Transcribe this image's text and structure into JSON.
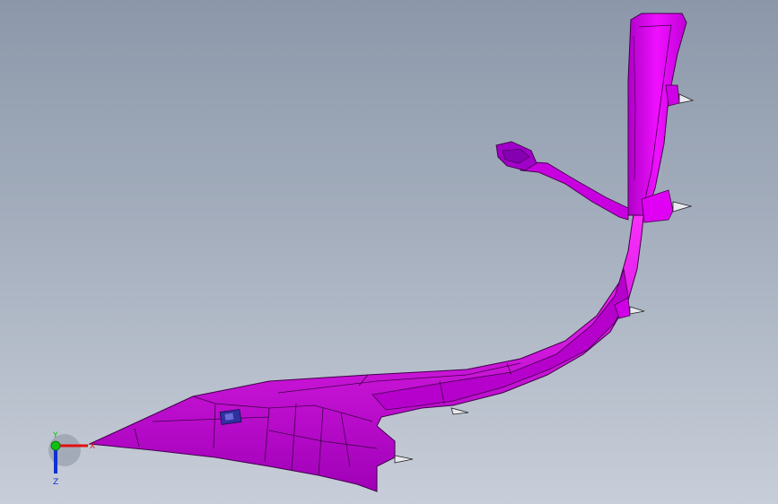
{
  "viewport": {
    "background_top": "#8c98aa",
    "background_bottom": "#c8ced9",
    "part_color": "#e600f0",
    "part_shadow_color": "#9c00b0",
    "edge_color": "#3a0040"
  },
  "triad": {
    "x_label": "X",
    "y_label": "Y",
    "z_label": "Z",
    "x_color": "#e01010",
    "y_color": "#10c010",
    "z_color": "#1030d0"
  }
}
